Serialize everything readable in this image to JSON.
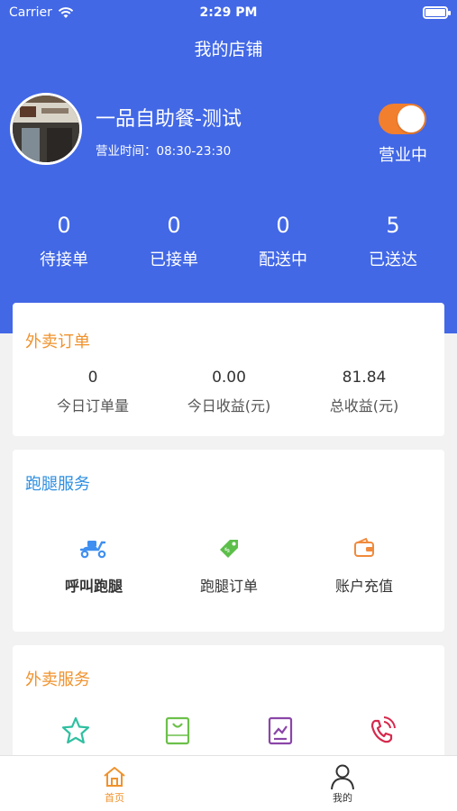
{
  "status_bar": {
    "carrier": "Carrier",
    "time": "2:29 PM"
  },
  "nav": {
    "title": "我的店铺"
  },
  "shop": {
    "name": "一品自助餐-测试",
    "hours": "营业时间：08:30-23:30",
    "open_status": "营业中",
    "open_toggle_on": true
  },
  "order_stats": [
    {
      "value": "0",
      "label": "待接单"
    },
    {
      "value": "0",
      "label": "已接单"
    },
    {
      "value": "0",
      "label": "配送中"
    },
    {
      "value": "5",
      "label": "已送达"
    }
  ],
  "takeout_orders": {
    "title": "外卖订单",
    "metrics": [
      {
        "value": "0",
        "label": "今日订单量"
      },
      {
        "value": "0.00",
        "label": "今日收益(元)"
      },
      {
        "value": "81.84",
        "label": "总收益(元)"
      }
    ]
  },
  "errand_service": {
    "title": "跑腿服务",
    "items": [
      {
        "label": "呼叫跑腿",
        "icon": "scooter-icon"
      },
      {
        "label": "跑腿订单",
        "icon": "tag-icon"
      },
      {
        "label": "账户充值",
        "icon": "wallet-icon"
      }
    ]
  },
  "takeout_service": {
    "title": "外卖服务",
    "items": [
      {
        "icon": "star-icon"
      },
      {
        "icon": "bag-icon"
      },
      {
        "icon": "chart-icon"
      },
      {
        "icon": "phone-icon"
      }
    ]
  },
  "tab_bar": [
    {
      "label": "首页",
      "icon": "home-icon",
      "active": true
    },
    {
      "label": "我的",
      "icon": "person-icon",
      "active": false
    }
  ],
  "colors": {
    "header_blue": "#4268e6",
    "accent_orange": "#f0922c",
    "accent_blue": "#2e8fe0",
    "toggle_orange": "#f27f2e"
  }
}
